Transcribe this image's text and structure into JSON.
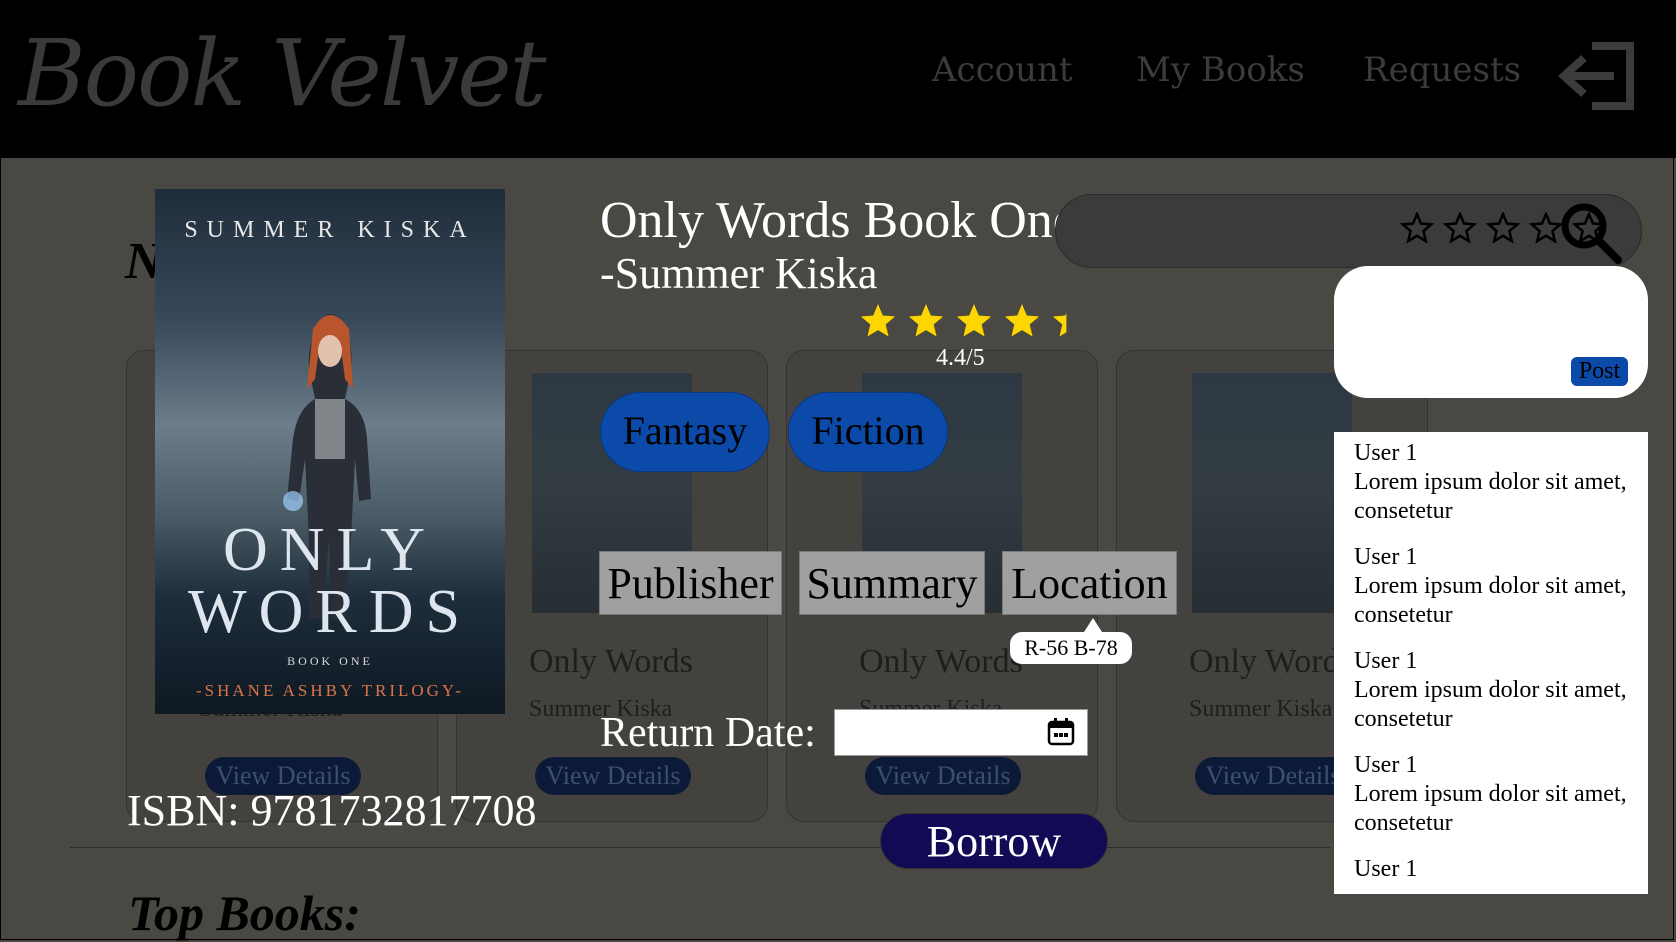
{
  "header": {
    "logo": "Book Velvet",
    "nav": [
      "Account",
      "My Books",
      "Requests"
    ]
  },
  "background": {
    "section_initial": "N",
    "top_books_label": "Top Books:",
    "cards": [
      {
        "title": "",
        "author": "Summer Kiska",
        "button": "View Details"
      },
      {
        "title": "Only Words",
        "author": "Summer Kiska",
        "button": "View Details"
      },
      {
        "title": "Only Words",
        "author": "Summer Kiska",
        "button": "View Details"
      },
      {
        "title": "Only Words",
        "author": "Summer Kiska",
        "button": "View Details"
      }
    ]
  },
  "cover": {
    "author": "SUMMER KISKA",
    "title_line1": "ONLY",
    "title_line2": "WORDS",
    "book": "BOOK ONE",
    "series": "-SHANE ASHBY TRILOGY-"
  },
  "book": {
    "title": "Only Words Book One",
    "author": "-Summer Kiska",
    "rating": 4.4,
    "rating_text": "4.4/5",
    "genres": [
      "Fantasy",
      "Fiction"
    ],
    "tabs": [
      "Publisher",
      "Summary",
      "Location"
    ],
    "location_tooltip": "R-56 B-78",
    "return_date_label": "Return Date:",
    "return_date_value": "",
    "isbn": "ISBN: 9781732817708",
    "borrow_label": "Borrow"
  },
  "review": {
    "user_rating": 0,
    "comment_value": "",
    "post_label": "Post"
  },
  "comments": [
    {
      "user": "User 1",
      "text": "Lorem ipsum dolor sit amet, consetetur"
    },
    {
      "user": "User 1",
      "text": "Lorem ipsum dolor sit amet, consetetur"
    },
    {
      "user": "User 1",
      "text": "Lorem ipsum dolor sit amet, consetetur"
    },
    {
      "user": "User 1",
      "text": "Lorem ipsum dolor sit amet, consetetur"
    },
    {
      "user": "User 1",
      "text": ""
    }
  ],
  "colors": {
    "header_bg": "#000000",
    "page_bg": "#4a4843",
    "genre_pill": "#0b4aa8",
    "borrow_button": "#120a55",
    "star_filled": "#ffd700",
    "tab_bg": "#a0a0a0"
  },
  "icons": {
    "logout": "logout-arrow-icon",
    "search": "search-icon",
    "calendar": "calendar-icon",
    "star": "star-icon"
  }
}
